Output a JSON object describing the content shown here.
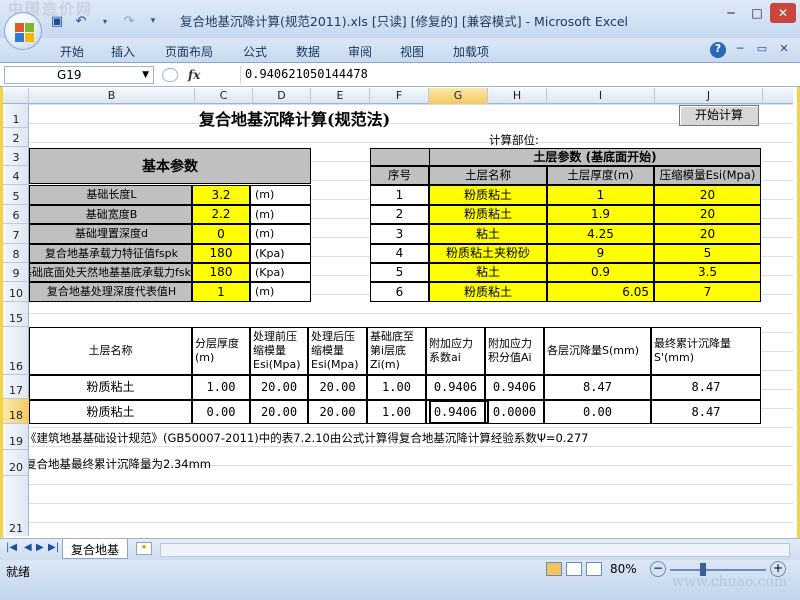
{
  "window": {
    "title": "复合地基沉降计算(规范2011).xls  [只读] [修复的]  [兼容模式] - Microsoft Excel",
    "watermark": "中国造价网"
  },
  "ribbon": {
    "tabs": [
      "开始",
      "插入",
      "页面布局",
      "公式",
      "数据",
      "审阅",
      "视图",
      "加载项"
    ]
  },
  "formula_bar": {
    "name_box": "G19",
    "fx": "fx",
    "value": "0.940621050144478"
  },
  "columns": [
    "B",
    "C",
    "D",
    "E",
    "F",
    "G",
    "H",
    "I",
    "J"
  ],
  "rows": [
    "1",
    "2",
    "3",
    "4",
    "5",
    "6",
    "7",
    "8",
    "9",
    "10",
    "15",
    "16",
    "17",
    "18",
    "19",
    "20",
    "21"
  ],
  "sheet": {
    "title": "复合地基沉降计算(规范法)",
    "calc_button": "开始计算",
    "calc_location_label": "计算部位:",
    "basic_header": "基本参数",
    "params": [
      {
        "label": "基础长度L",
        "value": "3.2",
        "unit": "(m)"
      },
      {
        "label": "基础宽度B",
        "value": "2.2",
        "unit": "(m)"
      },
      {
        "label": "基础埋置深度d",
        "value": "0",
        "unit": "(m)"
      },
      {
        "label": "复合地基承载力特征值fspk",
        "value": "180",
        "unit": "(Kpa)"
      },
      {
        "label": "基础底面处天然地基基底承载力fsk",
        "value": "180",
        "unit": "(Kpa)"
      },
      {
        "label": "复合地基处理深度代表值H",
        "value": "1",
        "unit": "(m)"
      }
    ],
    "soil_header": "土层参数 (基底面开始)",
    "soil_cols": [
      "序号",
      "土层名称",
      "土层厚度(m)",
      "压缩模量Esi(Mpa)"
    ],
    "soil_rows": [
      {
        "no": "1",
        "name": "粉质粘土",
        "thick": "1",
        "mod": "20"
      },
      {
        "no": "2",
        "name": "粉质粘土",
        "thick": "1.9",
        "mod": "20"
      },
      {
        "no": "3",
        "name": "粘土",
        "thick": "4.25",
        "mod": "20"
      },
      {
        "no": "4",
        "name": "粉质粘土夹粉砂",
        "thick": "9",
        "mod": "5"
      },
      {
        "no": "5",
        "name": "粘土",
        "thick": "0.9",
        "mod": "3.5"
      },
      {
        "no": "6",
        "name": "粉质粘土",
        "thick": "6.05",
        "mod": "7"
      }
    ],
    "result_cols": [
      "土层名称",
      "分层厚度(m)",
      "处理前压缩模量Esi(Mpa)",
      "处理后压缩模量Esi(Mpa)",
      "基础底至第i层底Zi(m)",
      "附加应力系数ai",
      "附加应力积分值Ai",
      "各层沉降量S(mm)",
      "最终累计沉降量S'(mm)"
    ],
    "result_rows": [
      [
        "粉质粘土",
        "1.00",
        "20.00",
        "20.00",
        "1.00",
        "0.9406",
        "0.9406",
        "8.47",
        "8.47"
      ],
      [
        "粉质粘土",
        "0.00",
        "20.00",
        "20.00",
        "1.00",
        "0.9406",
        "0.0000",
        "0.00",
        "8.47"
      ]
    ],
    "note1": "《建筑地基基础设计规范》(GB50007-2011)中的表7.2.10由公式计算得复合地基沉降计算经验系数Ψ=0.277",
    "note2": "复合地基最终累计沉降量为2.34mm"
  },
  "sheet_tabs": {
    "active": "复合地基"
  },
  "status": {
    "ready": "就绪",
    "zoom": "80%",
    "site": "www.chuao.com"
  }
}
